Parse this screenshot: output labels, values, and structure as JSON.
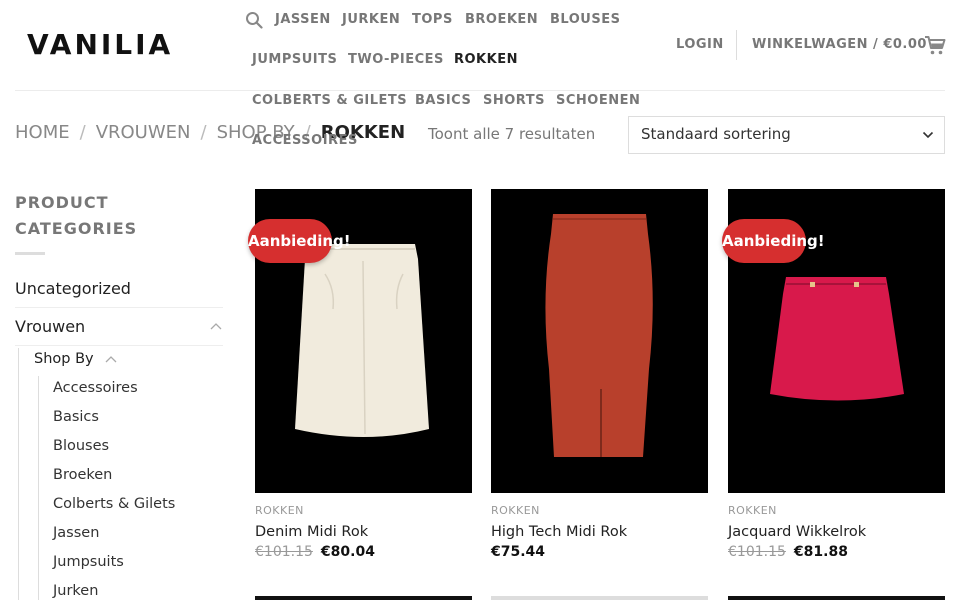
{
  "logo": "VANILIA",
  "nav": {
    "items": [
      {
        "label": "JASSEN"
      },
      {
        "label": "JURKEN"
      },
      {
        "label": "TOPS"
      },
      {
        "label": "BROEKEN"
      },
      {
        "label": "BLOUSES"
      },
      {
        "label": "JUMPSUITS"
      },
      {
        "label": "TWO-PIECES"
      },
      {
        "label": "ROKKEN"
      },
      {
        "label": "COLBERTS & GILETS"
      },
      {
        "label": "BASICS"
      },
      {
        "label": "SHORTS"
      },
      {
        "label": "SCHOENEN"
      },
      {
        "label": "ACCESSOIRES"
      }
    ],
    "active": "ROKKEN"
  },
  "header": {
    "login": "LOGIN",
    "cart": "WINKELWAGEN / €0.00"
  },
  "breadcrumb": [
    "HOME",
    "VROUWEN",
    "SHOP BY",
    "ROKKEN"
  ],
  "breadcrumb_sep": "/",
  "result_count": "Toont alle 7 resultaten",
  "sort": {
    "selected": "Standaard sortering"
  },
  "sidebar": {
    "title": "PRODUCT CATEGORIES",
    "categories": [
      "Uncategorized",
      "Vrouwen"
    ],
    "sub": "Shop By",
    "subcategories": [
      "Accessoires",
      "Basics",
      "Blouses",
      "Broeken",
      "Colberts & Gilets",
      "Jassen",
      "Jumpsuits",
      "Jurken"
    ]
  },
  "products": [
    {
      "category": "ROKKEN",
      "title": "Denim Midi Rok",
      "old_price": "€101.15",
      "price": "€80.04",
      "badge": "Aanbieding!",
      "color": "#f1ebdd"
    },
    {
      "category": "ROKKEN",
      "title": "High Tech Midi Rok",
      "old_price": "",
      "price": "€75.44",
      "badge": "",
      "color": "#b8402c"
    },
    {
      "category": "ROKKEN",
      "title": "Jacquard Wikkelrok",
      "old_price": "€101.15",
      "price": "€81.88",
      "badge": "Aanbieding!",
      "color": "#d8194b"
    }
  ],
  "colors": {
    "accent": "#d62f2f",
    "text": "#222222",
    "muted": "#777777"
  }
}
